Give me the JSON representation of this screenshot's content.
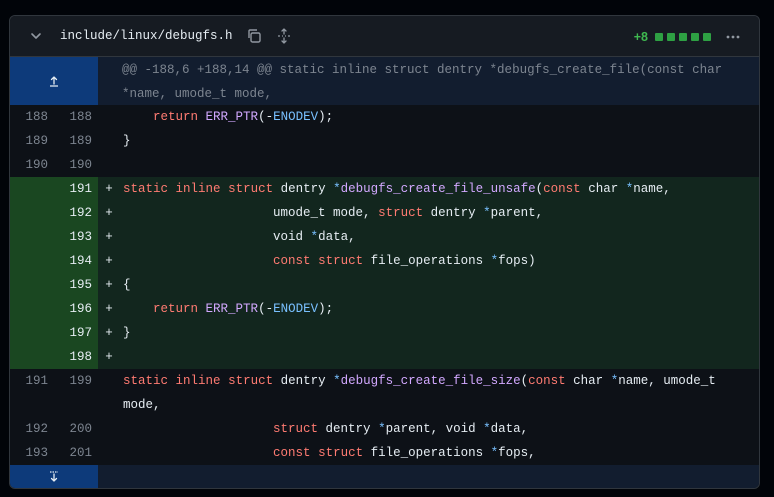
{
  "file": {
    "name": "include/linux/debugfs.h",
    "additions": "+8",
    "diffstat_blocks": 5
  },
  "hunk": {
    "header": "@@ -188,6 +188,14 @@ static inline struct dentry *debugfs_create_file(const char\n*name, umode_t mode,"
  },
  "lines": [
    {
      "old": "188",
      "new": "188",
      "sign": "",
      "type": "ctx"
    },
    {
      "old": "189",
      "new": "189",
      "sign": "",
      "type": "ctx"
    },
    {
      "old": "190",
      "new": "190",
      "sign": "",
      "type": "ctx"
    },
    {
      "old": "",
      "new": "191",
      "sign": "+",
      "type": "add"
    },
    {
      "old": "",
      "new": "192",
      "sign": "+",
      "type": "add"
    },
    {
      "old": "",
      "new": "193",
      "sign": "+",
      "type": "add"
    },
    {
      "old": "",
      "new": "194",
      "sign": "+",
      "type": "add"
    },
    {
      "old": "",
      "new": "195",
      "sign": "+",
      "type": "add"
    },
    {
      "old": "",
      "new": "196",
      "sign": "+",
      "type": "add"
    },
    {
      "old": "",
      "new": "197",
      "sign": "+",
      "type": "add"
    },
    {
      "old": "",
      "new": "198",
      "sign": "+",
      "type": "add"
    },
    {
      "old": "191",
      "new": "199",
      "sign": "",
      "type": "ctx"
    },
    {
      "old": "192",
      "new": "200",
      "sign": "",
      "type": "ctx"
    },
    {
      "old": "193",
      "new": "201",
      "sign": "",
      "type": "ctx"
    }
  ],
  "code": {
    "l0_a": "    ",
    "l0_kw": "return",
    "l0_fn": "ERR_PTR",
    "l0_p1": "(-",
    "l0_c": "ENODEV",
    "l0_p2": ");",
    "l1": "}",
    "l3_kw1": "static",
    "l3_kw2": "inline",
    "l3_kw3": "struct",
    "l3_t1": " dentry ",
    "l3_op": "*",
    "l3_fn": "debugfs_create_file_unsafe",
    "l3_p": "(",
    "l3_kw4": "const",
    "l3_t2": " char ",
    "l3_op2": "*",
    "l3_t3": "name,",
    "l4_ind": "                    ",
    "l4_t1": "umode_t mode, ",
    "l4_kw": "struct",
    "l4_t2": " dentry ",
    "l4_op": "*",
    "l4_t3": "parent,",
    "l5_t1": "void ",
    "l5_op": "*",
    "l5_t2": "data,",
    "l6_kw1": "const",
    "l6_kw2": "struct",
    "l6_t1": " file_operations ",
    "l6_op": "*",
    "l6_t2": "fops)",
    "l7": "{",
    "l8_kw": "return",
    "l8_fn": "ERR_PTR",
    "l8_p1": "(-",
    "l8_c": "ENODEV",
    "l8_p2": ");",
    "l9": "}",
    "l11_kw1": "static",
    "l11_kw2": "inline",
    "l11_kw3": "struct",
    "l11_t1": " dentry ",
    "l11_op": "*",
    "l11_fn": "debugfs_create_file_size",
    "l11_p": "(",
    "l11_kw4": "const",
    "l11_t2": " char ",
    "l11_op2": "*",
    "l11_t3": "name, umode_t",
    "l11_t4": "mode,",
    "l12_kw": "struct",
    "l12_t1": " dentry ",
    "l12_op": "*",
    "l12_t2": "parent, void ",
    "l12_op2": "*",
    "l12_t3": "data,",
    "l13_kw1": "const",
    "l13_kw2": "struct",
    "l13_t1": " file_operations ",
    "l13_op": "*",
    "l13_t2": "fops,"
  }
}
